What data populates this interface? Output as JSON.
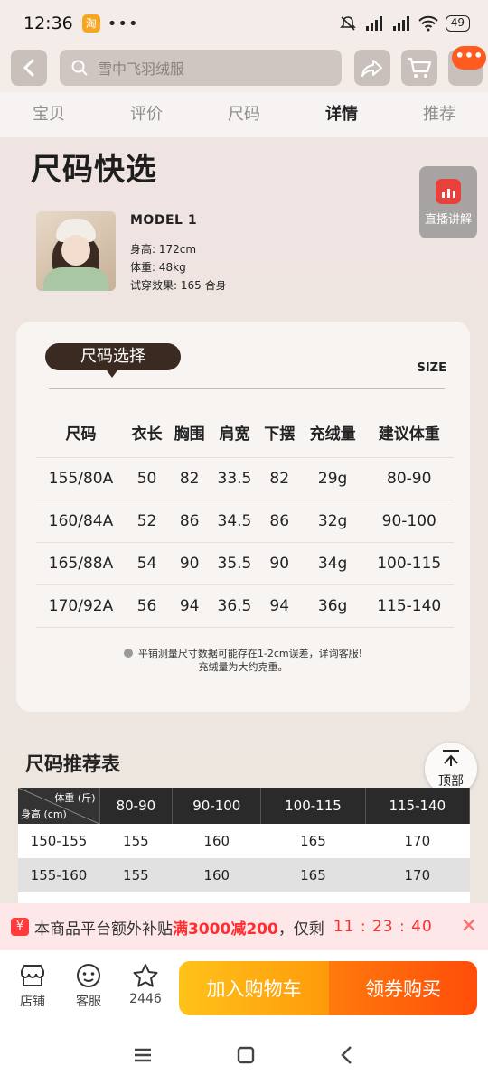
{
  "status": {
    "time": "12:36",
    "battery": "49",
    "app_badge": "淘"
  },
  "search": {
    "placeholder": "雪中飞羽绒服"
  },
  "tabs": [
    "宝贝",
    "评价",
    "尺码",
    "详情",
    "推荐"
  ],
  "active_tab": "详情",
  "section": {
    "title": "尺码快选",
    "live_label": "直播讲解"
  },
  "model": {
    "name": "MODEL 1",
    "height": "身高: 172cm",
    "weight": "体重: 48kg",
    "fit": "试穿效果: 165 合身"
  },
  "size_card": {
    "pill": "尺码选择",
    "size_label": "SIZE",
    "headers": [
      "尺码",
      "衣长",
      "胸围",
      "肩宽",
      "下摆",
      "充绒量",
      "建议体重"
    ],
    "rows": [
      [
        "155/80A",
        "50",
        "82",
        "33.5",
        "82",
        "29g",
        "80-90"
      ],
      [
        "160/84A",
        "52",
        "86",
        "34.5",
        "86",
        "32g",
        "90-100"
      ],
      [
        "165/88A",
        "54",
        "90",
        "35.5",
        "90",
        "34g",
        "100-115"
      ],
      [
        "170/92A",
        "56",
        "94",
        "36.5",
        "94",
        "36g",
        "115-140"
      ]
    ],
    "note_line1": "平铺测量尺寸数据可能存在1-2cm误差，详询客服!",
    "note_line2": "充绒量为大约克重。"
  },
  "recommend": {
    "title": "尺码推荐表",
    "diag_top": "体重 (斤)",
    "diag_bottom": "身高 (cm)",
    "columns": [
      "80-90",
      "90-100",
      "100-115",
      "115-140"
    ],
    "rows": [
      {
        "label": "150-155",
        "values": [
          "155",
          "160",
          "165",
          "170"
        ]
      },
      {
        "label": "155-160",
        "values": [
          "155",
          "160",
          "165",
          "170"
        ]
      }
    ]
  },
  "to_top": "顶部",
  "promo": {
    "icon": "¥",
    "prefix": "本商品平台额外补贴",
    "highlight": "满3000减200",
    "suffix": "，仅剩",
    "countdown": "11 : 23 : 40"
  },
  "bottom_bar": {
    "shop": "店铺",
    "service": "客服",
    "favorites": "2446",
    "add_cart": "加入购物车",
    "buy": "领券购买"
  }
}
